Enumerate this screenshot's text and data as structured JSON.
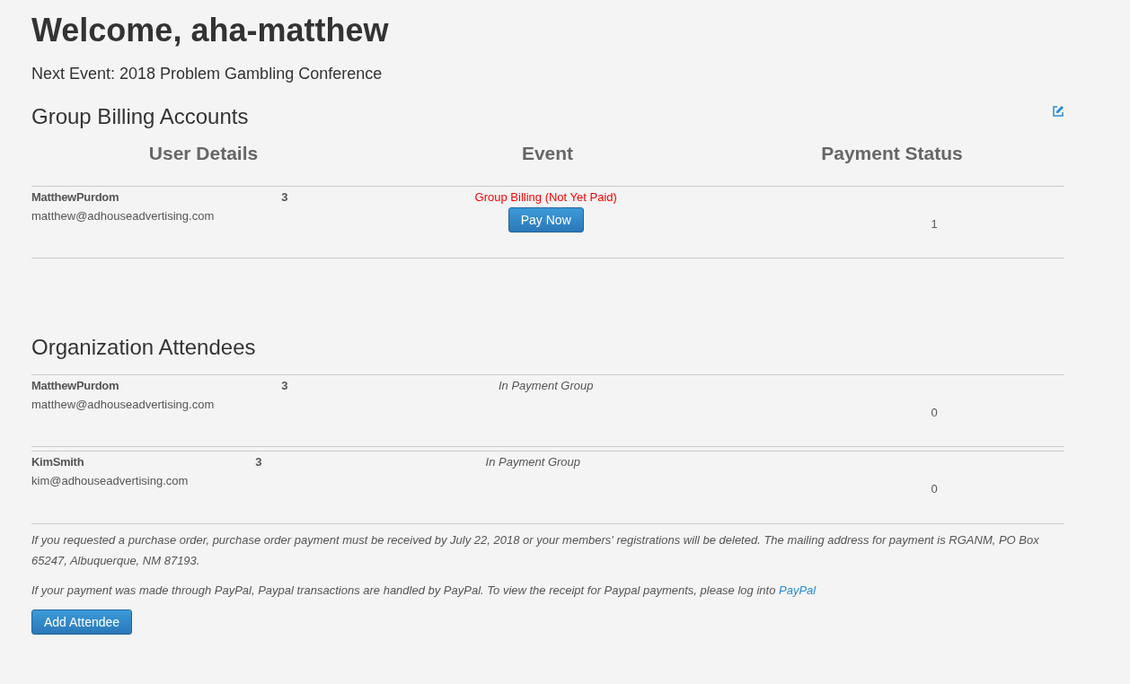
{
  "welcome": "Welcome, aha-matthew",
  "next_event": "Next Event: 2018 Problem Gambling Conference",
  "billing": {
    "title": "Group Billing Accounts",
    "columns": [
      "User Details",
      "Event",
      "Payment Status"
    ],
    "rows": [
      {
        "name": "MatthewPurdom",
        "email": "matthew@adhouseadvertising.com",
        "count": "3",
        "event_status": "Group Billing (Not Yet Paid)",
        "button": "Pay Now",
        "payment_status": "1"
      }
    ]
  },
  "attendees": {
    "title": "Organization Attendees",
    "rows": [
      {
        "name": "MatthewPurdom",
        "email": "matthew@adhouseadvertising.com",
        "count": "3",
        "event_status": "In Payment Group",
        "payment_status": "0"
      },
      {
        "name": "KimSmith",
        "email": "kim@adhouseadvertising.com",
        "count": "3",
        "event_status": "In Payment Group",
        "payment_status": "0"
      }
    ]
  },
  "notes": [
    "If you requested a purchase order, purchase order payment must be received by July 22, 2018 or your members' registrations will be deleted. The mailing address for payment is RGANM, PO Box 65247, Albuquerque, NM 87193."
  ],
  "paypal_note": {
    "text": "If your payment was made through PayPal, Paypal transactions are handled by PayPal. To view the receipt for Paypal payments, please log into",
    "link": "PayPal"
  },
  "add_button": "Add Attendee"
}
